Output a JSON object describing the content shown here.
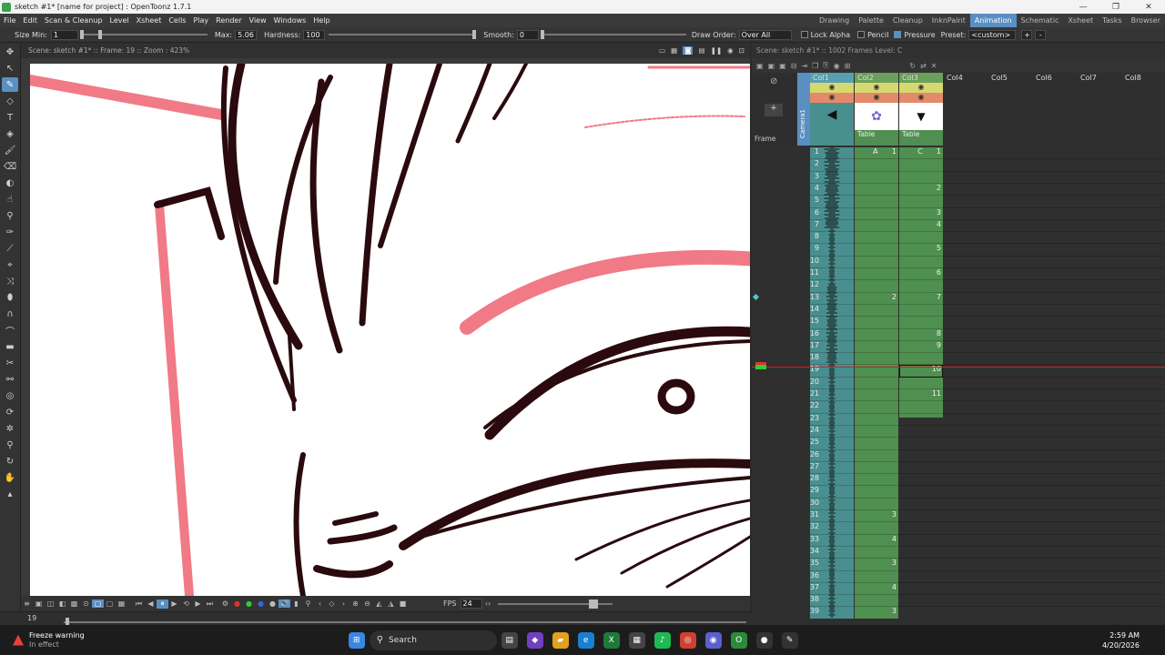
{
  "window": {
    "title": "sketch #1* [name for project] : OpenToonz 1.7.1",
    "controls": [
      "—",
      "❐",
      "✕"
    ]
  },
  "menu": {
    "items": [
      "File",
      "Edit",
      "Scan & Cleanup",
      "Level",
      "Xsheet",
      "Cells",
      "Play",
      "Render",
      "View",
      "Windows",
      "Help"
    ],
    "rooms": [
      "Drawing",
      "Palette",
      "Cleanup",
      "InknPaint",
      "Animation",
      "Schematic",
      "Xsheet",
      "Tasks",
      "Browser"
    ],
    "active_room": "Animation"
  },
  "tool_options": {
    "size_min_label": "Size Min:",
    "size_min_value": "1",
    "max_label": "Max:",
    "max_value": "5.06",
    "hardness_label": "Hardness:",
    "hardness_value": "100",
    "smooth_label": "Smooth:",
    "smooth_value": "0",
    "draw_order_label": "Draw Order:",
    "draw_order_value": "Over All",
    "lock_alpha_label": "Lock Alpha",
    "pencil_label": "Pencil",
    "pressure_label": "Pressure",
    "preset_label": "Preset:",
    "preset_value": "<custom>",
    "add_preset": "+",
    "remove_preset": "-"
  },
  "viewer": {
    "header": "Scene: sketch #1*  ::  Frame: 19  ::  Zoom : 423%",
    "fps_label": "FPS",
    "fps_value": "24",
    "frame_field": "19"
  },
  "status": {
    "warning_title": "Freeze warning",
    "warning_text": "In effect"
  },
  "xsheet": {
    "header": "Scene: sketch #1*  ::  1002 Frames  Level: C",
    "frame_label": "Frame",
    "camera_label": "Camera1",
    "columns": [
      {
        "name": "Col1",
        "pegbar": ""
      },
      {
        "name": "Col2",
        "pegbar": "Table"
      },
      {
        "name": "Col3",
        "pegbar": "Table"
      },
      {
        "name": "Col4",
        "pegbar": ""
      },
      {
        "name": "Col5",
        "pegbar": ""
      },
      {
        "name": "Col6",
        "pegbar": ""
      },
      {
        "name": "Col7",
        "pegbar": ""
      },
      {
        "name": "Col8",
        "pegbar": ""
      }
    ],
    "frames": [
      "1",
      "2",
      "3",
      "4",
      "5",
      "6",
      "7",
      "8",
      "9",
      "10",
      "11",
      "12",
      "13",
      "14",
      "15",
      "16",
      "17",
      "18",
      "19",
      "20",
      "21",
      "22",
      "23",
      "24",
      "25",
      "26",
      "27",
      "28",
      "29",
      "30",
      "31",
      "32",
      "33",
      "34",
      "35",
      "36",
      "37",
      "38",
      "39"
    ],
    "current_frame": "19",
    "col2_cells": [
      {
        "frame": 1,
        "text": "A      1"
      },
      {
        "frame": 13,
        "text": "2"
      },
      {
        "frame": 31,
        "text": "3"
      },
      {
        "frame": 33,
        "text": "4"
      },
      {
        "frame": 35,
        "text": "3"
      },
      {
        "frame": 37,
        "text": "4"
      },
      {
        "frame": 39,
        "text": "3"
      }
    ],
    "col3_cells": [
      {
        "frame": 1,
        "text": "C      1"
      },
      {
        "frame": 4,
        "text": "2"
      },
      {
        "frame": 6,
        "text": "3"
      },
      {
        "frame": 7,
        "text": "4"
      },
      {
        "frame": 9,
        "text": "5"
      },
      {
        "frame": 11,
        "text": "6"
      },
      {
        "frame": 13,
        "text": "7"
      },
      {
        "frame": 16,
        "text": "8"
      },
      {
        "frame": 17,
        "text": "9"
      },
      {
        "frame": 19,
        "text": "10"
      },
      {
        "frame": 21,
        "text": "11"
      }
    ]
  },
  "taskbar": {
    "search_placeholder": "Search",
    "time": "2:59 AM",
    "date": "4/20/2026"
  },
  "colors": {
    "accent": "#5a8fc2",
    "col1": "#4a8f8f",
    "col2": "#4f8f4f",
    "col3": "#4f8f4f",
    "current_frame_line": "#d02020",
    "onion_red": "#f07080"
  }
}
